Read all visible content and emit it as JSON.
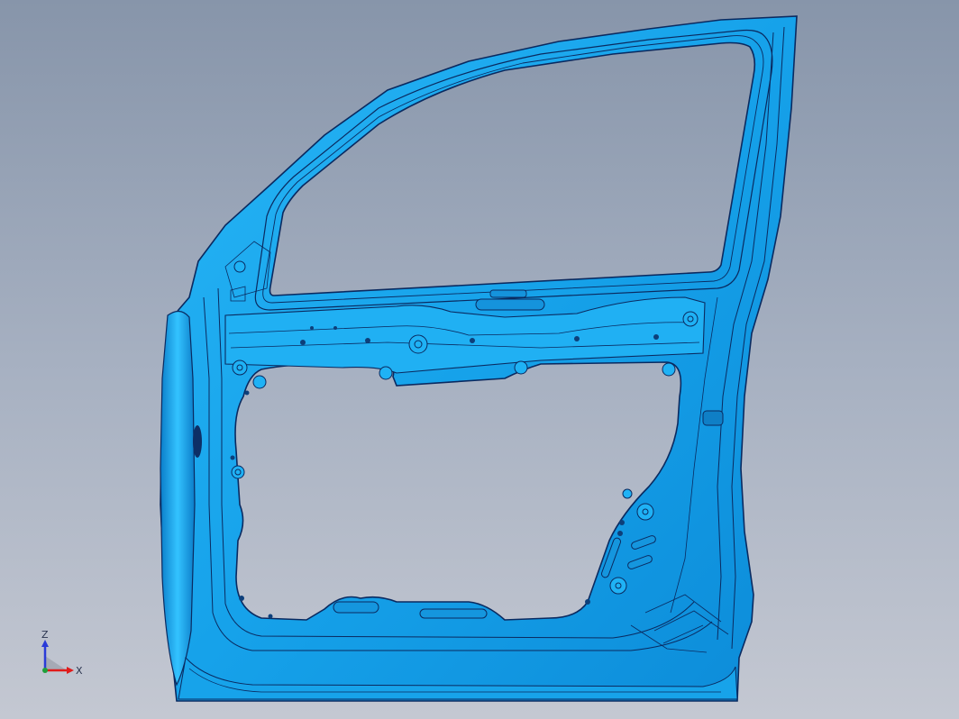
{
  "viewport": {
    "model": "door-inner-panel",
    "background_top": "#8795aa",
    "background_bottom": "#c4c8d2",
    "model_color": "#1aa6ec",
    "edge_color": "#0a2a60"
  },
  "triad": {
    "z_label": "Z",
    "x_label": "X",
    "z_color": "#2a3bd8",
    "x_color": "#e01b1b",
    "y_color": "#1fa03a"
  }
}
